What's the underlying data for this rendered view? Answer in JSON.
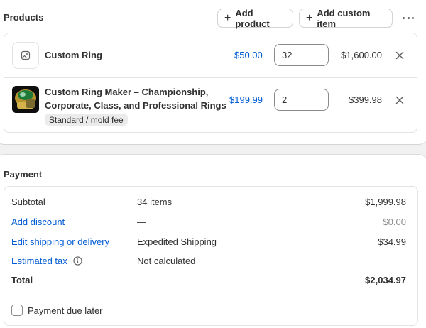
{
  "products": {
    "title": "Products",
    "add_product_label": "Add product",
    "add_custom_label": "Add custom item",
    "items": [
      {
        "name": "Custom Ring",
        "price": "$50.00",
        "quantity": "32",
        "total": "$1,600.00",
        "thumbnail": "image-placeholder-icon"
      },
      {
        "name_line1": "Custom Ring Maker – Championship,",
        "name_line2": "Corporate, Class, and Professional Rings",
        "price": "$199.99",
        "quantity": "2",
        "total": "$399.98",
        "variant": "Standard / mold fee",
        "thumbnail": "product-photo"
      }
    ]
  },
  "payment": {
    "title": "Payment",
    "subtotal_label": "Subtotal",
    "subtotal_items": "34 items",
    "subtotal_value": "$1,999.98",
    "discount_label": "Add discount",
    "discount_mid": "—",
    "discount_value": "$0.00",
    "shipping_label": "Edit shipping or delivery",
    "shipping_mid": "Expedited Shipping",
    "shipping_value": "$34.99",
    "tax_label": "Estimated tax",
    "tax_mid": "Not calculated",
    "total_label": "Total",
    "total_value": "$2,034.97",
    "due_later_label": "Payment due later"
  },
  "colors": {
    "link": "#005bd3",
    "text": "#303030",
    "muted": "#8a8a8a",
    "background": "#f1f1f1"
  }
}
